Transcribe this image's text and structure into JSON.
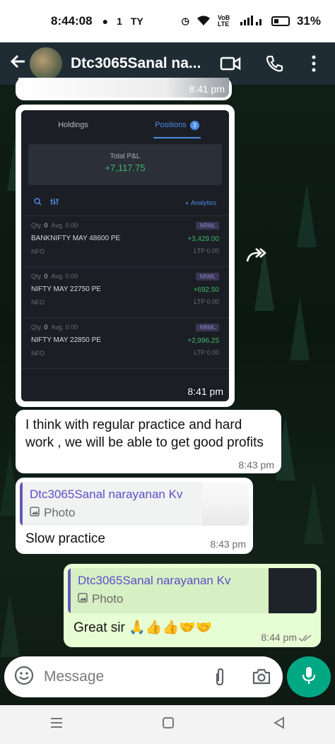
{
  "status_bar": {
    "time": "8:44:08",
    "data_speed": "1",
    "network_label": "VoB LTE",
    "battery": "31%"
  },
  "header": {
    "title": "Dtc3065Sanal na..."
  },
  "messages": [
    {
      "type": "image",
      "time": "8:41 pm"
    },
    {
      "type": "image",
      "time": "8:41 pm",
      "image": {
        "tabs": [
          "Holdings",
          "Positions"
        ],
        "positions_count": "3",
        "total_pnl_label": "Total P&L",
        "total_pnl_value": "+7,117.75",
        "analytics_label": "Analytics",
        "rows": [
          {
            "qty": "0",
            "avg": "0.00",
            "tag": "NRML",
            "instrument": "BANKNIFTY MAY 48600 PE",
            "pnl": "+3,429.00",
            "exchange": "NFO",
            "ltp": "LTP 0.00"
          },
          {
            "qty": "0",
            "avg": "0.00",
            "tag": "NRML",
            "instrument": "NIFTY MAY 22750 PE",
            "pnl": "+692.50",
            "exchange": "NFO",
            "ltp": "LTP 0.00"
          },
          {
            "qty": "0",
            "avg": "0.00",
            "tag": "NRML",
            "instrument": "NIFTY MAY 22850 PE",
            "pnl": "+2,996.25",
            "exchange": "NFO",
            "ltp": "LTP 0.00"
          }
        ]
      }
    },
    {
      "type": "text",
      "text": "I think with regular practice and hard work , we will be able to get good profits",
      "time": "8:43 pm"
    },
    {
      "type": "reply",
      "quoted_name": "Dtc3065Sanal narayanan Kv",
      "quoted_type": "Photo",
      "text": "Slow practice",
      "time": "8:43 pm"
    },
    {
      "type": "reply_out",
      "quoted_name": "Dtc3065Sanal narayanan Kv",
      "quoted_type": "Photo",
      "text": "Great sir 🙏👍👍🤝🤝",
      "time": "8:44 pm"
    }
  ],
  "input": {
    "placeholder": "Message"
  },
  "icons": [
    "back-arrow-icon",
    "video-call-icon",
    "phone-icon",
    "more-vert-icon",
    "forward-icon",
    "emoji-icon",
    "attach-icon",
    "camera-icon",
    "mic-icon",
    "recents-icon",
    "home-icon",
    "back-nav-icon",
    "double-check-icon"
  ],
  "colors": {
    "header": "#1f2c34",
    "outgoing": "#e7fdd3",
    "accent": "#00a884",
    "quote_name": "#5b4fc9",
    "profit": "#3eb86b"
  }
}
